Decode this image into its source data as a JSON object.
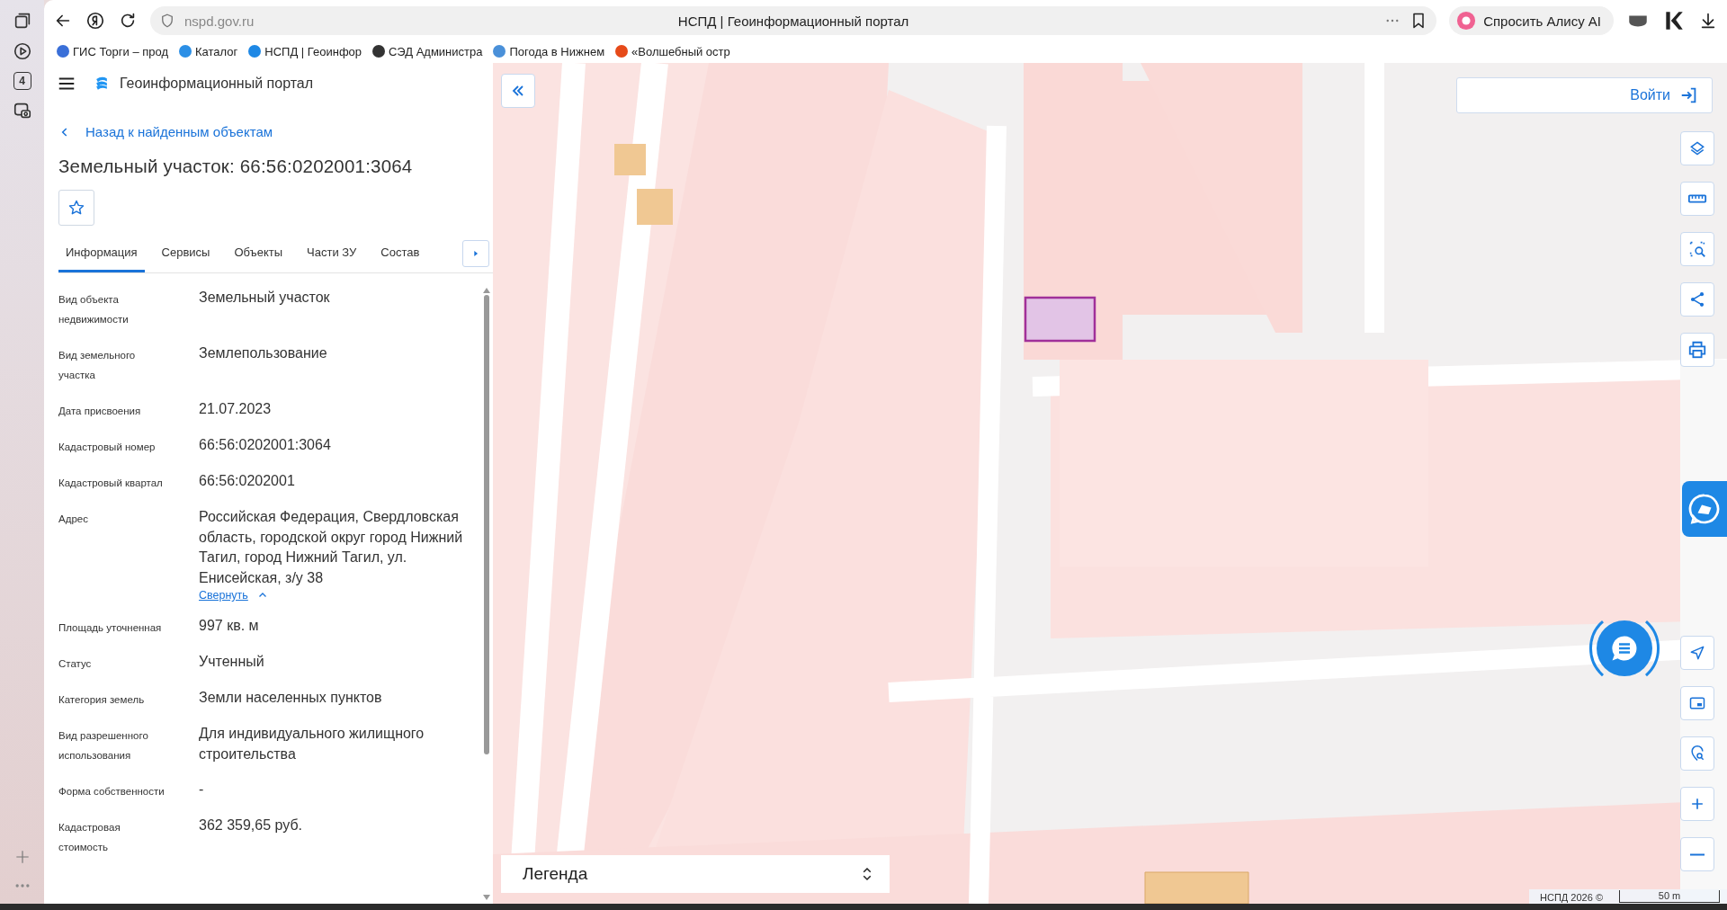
{
  "browser": {
    "address": "nspd.gov.ru",
    "page_title": "НСПД | Геоинформационный портал",
    "alice_button": "Спросить Алису AI",
    "side_badge": "4",
    "bookmarks": [
      {
        "label": "ГИС Торги – прод"
      },
      {
        "label": "Каталог"
      },
      {
        "label": "НСПД | Геоинфор"
      },
      {
        "label": "СЭД Администра"
      },
      {
        "label": "Погода в Нижнем"
      },
      {
        "label": "«Волшебный остр"
      }
    ]
  },
  "panel": {
    "app_title": "Геоинформационный портал",
    "back_link": "Назад к найденным объектам",
    "heading": "Земельный участок: 66:56:0202001:3064",
    "tabs": [
      {
        "label": "Информация",
        "selected": true
      },
      {
        "label": "Сервисы",
        "selected": false
      },
      {
        "label": "Объекты",
        "selected": false
      },
      {
        "label": "Части ЗУ",
        "selected": false
      },
      {
        "label": "Состав",
        "selected": false
      }
    ],
    "fields": [
      {
        "label": "Вид объекта недвижимости",
        "value": "Земельный участок"
      },
      {
        "label": "Вид земельного участка",
        "value": "Землепользование"
      },
      {
        "label": "Дата присвоения",
        "value": "21.07.2023"
      },
      {
        "label": "Кадастровый номер",
        "value": "66:56:0202001:3064"
      },
      {
        "label": "Кадастровый квартал",
        "value": "66:56:0202001"
      },
      {
        "label": "Адрес",
        "value": "Российская Федерация, Свердловская область, городской округ город Нижний Тагил, город Нижний Тагил, ул. Енисейская, з/у 38",
        "toggle": "Свернуть"
      },
      {
        "label": "Площадь уточненная",
        "value": "997 кв. м"
      },
      {
        "label": "Статус",
        "value": "Учтенный"
      },
      {
        "label": "Категория земель",
        "value": "Земли населенных пунктов"
      },
      {
        "label": "Вид разрешенного использования",
        "value": "Для индивидуального жилищного строительства"
      },
      {
        "label": "Форма собственности",
        "value": "-"
      },
      {
        "label": "Кадастровая стоимость",
        "value": "362 359,65 руб."
      }
    ]
  },
  "map": {
    "kind": "picture",
    "login_button": "Войти",
    "legend": "Легенда",
    "attribution": "НСПД 2026 ©",
    "scale": "50 m"
  }
}
